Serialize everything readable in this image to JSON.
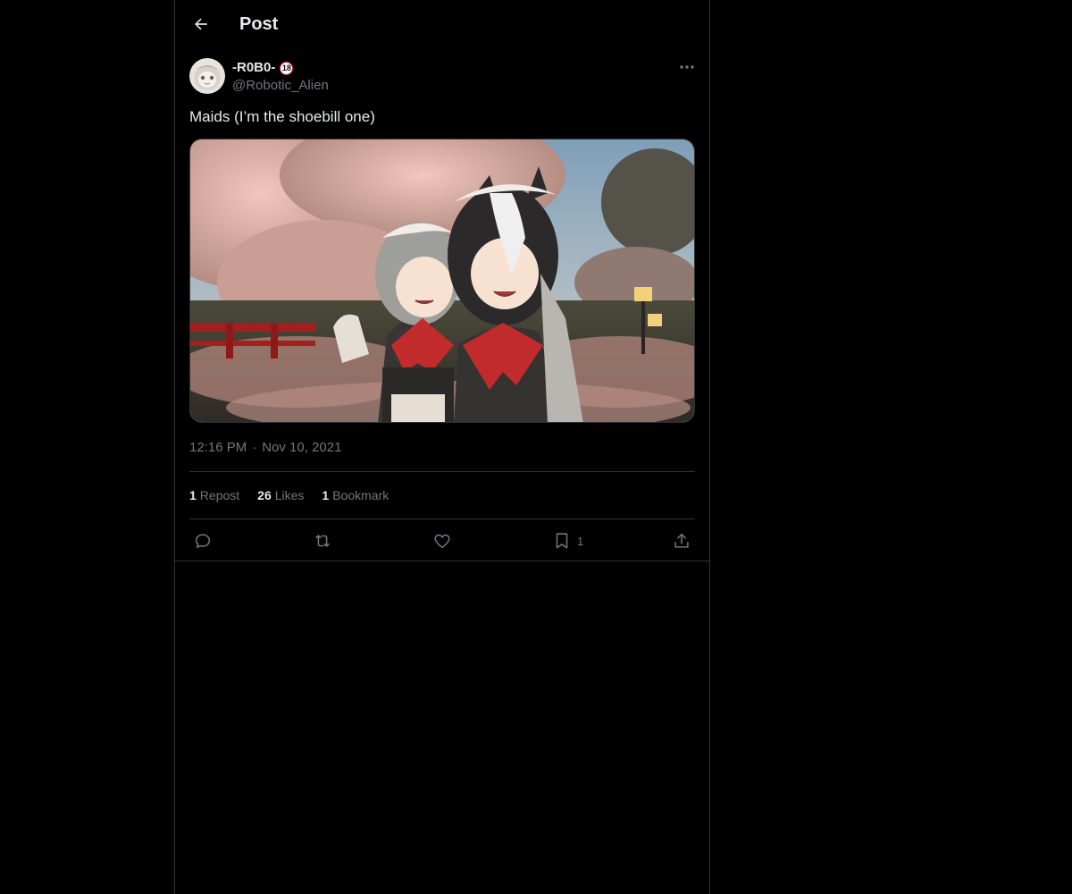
{
  "header": {
    "title": "Post",
    "back_icon": "arrow-left-icon"
  },
  "post": {
    "author": {
      "display_name": "-R0B0-",
      "badge": "18",
      "handle": "@Robotic_Alien"
    },
    "text": "Maids (I’m the shoebill one)",
    "time": "12:16 PM",
    "date": "Nov 10, 2021",
    "separator": "·",
    "stats": {
      "reposts_count": "1",
      "reposts_label": "Repost",
      "likes_count": "26",
      "likes_label": "Likes",
      "bookmarks_count": "1",
      "bookmarks_label": "Bookmark"
    },
    "actions": {
      "reply_icon": "reply-icon",
      "repost_icon": "repost-icon",
      "like_icon": "heart-icon",
      "bookmark_icon": "bookmark-icon",
      "bookmark_count": "1",
      "share_icon": "share-icon"
    }
  },
  "colors": {
    "background": "#000000",
    "text": "#e7e9ea",
    "secondary": "#71767b",
    "border": "#2f3336",
    "badge_ring": "#e0245e"
  }
}
